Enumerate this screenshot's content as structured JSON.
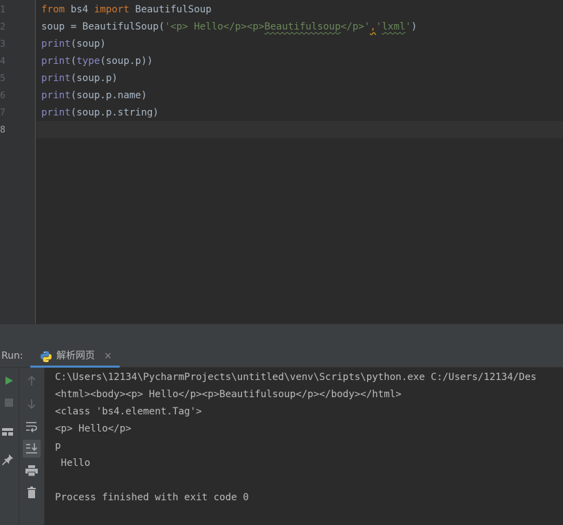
{
  "editor": {
    "line_numbers": [
      "1",
      "2",
      "3",
      "4",
      "5",
      "6",
      "7",
      "8"
    ],
    "lines": [
      [
        {
          "t": "from",
          "c": "kw"
        },
        {
          "t": " bs4 "
        },
        {
          "t": "import",
          "c": "kw"
        },
        {
          "t": " BeautifulSoup"
        }
      ],
      [
        {
          "t": "soup = BeautifulSoup("
        },
        {
          "t": "'<p> Hello</p><p>",
          "c": "st"
        },
        {
          "t": "Beautifulsoup",
          "c": "st squiggle"
        },
        {
          "t": "</p>'",
          "c": "st"
        },
        {
          "t": ",",
          "c": "warn-comma"
        },
        {
          "t": "'",
          "c": "st"
        },
        {
          "t": "lxml",
          "c": "st squiggle"
        },
        {
          "t": "'",
          "c": "st"
        },
        {
          "t": ")"
        }
      ],
      [
        {
          "t": "print",
          "c": "bi"
        },
        {
          "t": "(soup)"
        }
      ],
      [
        {
          "t": "print",
          "c": "bi"
        },
        {
          "t": "("
        },
        {
          "t": "type",
          "c": "bi"
        },
        {
          "t": "(soup.p))"
        }
      ],
      [
        {
          "t": "print",
          "c": "bi"
        },
        {
          "t": "(soup.p)"
        }
      ],
      [
        {
          "t": "print",
          "c": "bi"
        },
        {
          "t": "(soup.p.name)"
        }
      ],
      [
        {
          "t": "print",
          "c": "bi"
        },
        {
          "t": "(soup.p.string)"
        }
      ],
      []
    ]
  },
  "run": {
    "label": "Run:",
    "tab_label": "解析网页",
    "close_glyph": "×",
    "output": [
      "C:\\Users\\12134\\PycharmProjects\\untitled\\venv\\Scripts\\python.exe C:/Users/12134/Des",
      "<html><body><p> Hello</p><p>Beautifulsoup</p></body></html>",
      "<class 'bs4.element.Tag'>",
      "<p> Hello</p>",
      "p",
      " Hello",
      "",
      "Process finished with exit code 0"
    ]
  },
  "icons": {
    "run": "play-icon",
    "stop": "stop-icon",
    "layout": "layout-icon",
    "pin": "pin-icon",
    "up": "arrow-up-icon",
    "down": "arrow-down-icon",
    "wrap": "soft-wrap-icon",
    "scroll": "scroll-to-end-icon",
    "print": "print-icon",
    "trash": "trash-icon"
  },
  "colors": {
    "keyword": "#cc7832",
    "builtin": "#8888c6",
    "string": "#6a8759",
    "text": "#a9b7c6",
    "run_green": "#499c54",
    "tab_underline": "#4a88c7"
  }
}
